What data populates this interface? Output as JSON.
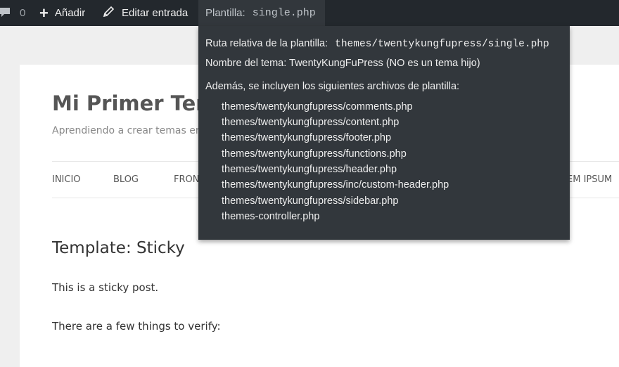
{
  "adminbar": {
    "comments_count": "0",
    "add_label": "Añadir",
    "edit_label": "Editar entrada",
    "template_label": "Plantilla:",
    "template_file": "single.php"
  },
  "site": {
    "title": "Mi Primer Tem",
    "description": "Aprendiendo a crear temas en",
    "nav": [
      "INICIO",
      "BLOG",
      "FRON",
      "EM IPSUM"
    ]
  },
  "post": {
    "title": "Template: Sticky",
    "paragraphs": [
      "This is a sticky post.",
      "There are a few things to verify:"
    ]
  },
  "dropdown": {
    "relative_path_label": "Ruta relativa de la plantilla:",
    "relative_path": "themes/twentykungfupress/single.php",
    "theme_name_line": "Nombre del tema: TwentyKungFuPress (NO es un tema hijo)",
    "included_label": "Además, se incluyen los siguientes archivos de plantilla:",
    "files": [
      "themes/twentykungfupress/comments.php",
      "themes/twentykungfupress/content.php",
      "themes/twentykungfupress/footer.php",
      "themes/twentykungfupress/functions.php",
      "themes/twentykungfupress/header.php",
      "themes/twentykungfupress/inc/custom-header.php",
      "themes/twentykungfupress/sidebar.php",
      "themes-controller.php"
    ]
  },
  "colors": {
    "adminbar_bg": "#23282d",
    "dropdown_bg": "#32373c"
  },
  "icons": [
    "comment-icon",
    "plus-icon",
    "pencil-icon"
  ]
}
